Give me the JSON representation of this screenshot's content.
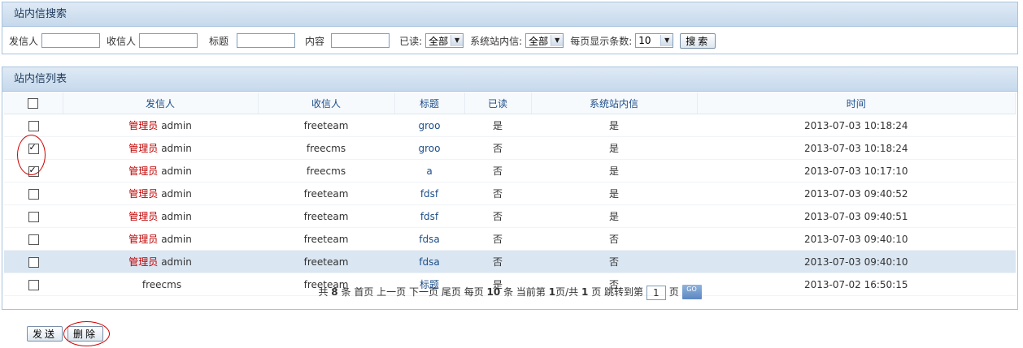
{
  "search": {
    "title": "站内信搜索",
    "sender_label": "发信人",
    "receiver_label": "收信人",
    "subject_label": "标题",
    "content_label": "内容",
    "read_label": "已读:",
    "read_value": "全部",
    "system_label": "系统站内信:",
    "system_value": "全部",
    "pagesize_label": "每页显示条数:",
    "pagesize_value": "10",
    "search_button": "搜索"
  },
  "list": {
    "title": "站内信列表",
    "columns": [
      "发信人",
      "收信人",
      "标题",
      "已读",
      "系统站内信",
      "时间"
    ],
    "rows": [
      {
        "role": "管理员",
        "sender": "admin",
        "receiver": "freeteam",
        "subject": "groo",
        "read": "是",
        "system": "是",
        "time": "2013-07-03 10:18:24",
        "checked": false
      },
      {
        "role": "管理员",
        "sender": "admin",
        "receiver": "freecms",
        "subject": "groo",
        "read": "否",
        "system": "是",
        "time": "2013-07-03 10:18:24",
        "checked": true
      },
      {
        "role": "管理员",
        "sender": "admin",
        "receiver": "freecms",
        "subject": "a",
        "read": "否",
        "system": "是",
        "time": "2013-07-03 10:17:10",
        "checked": true
      },
      {
        "role": "管理员",
        "sender": "admin",
        "receiver": "freeteam",
        "subject": "fdsf",
        "read": "否",
        "system": "是",
        "time": "2013-07-03 09:40:52",
        "checked": false
      },
      {
        "role": "管理员",
        "sender": "admin",
        "receiver": "freeteam",
        "subject": "fdsf",
        "read": "否",
        "system": "是",
        "time": "2013-07-03 09:40:51",
        "checked": false
      },
      {
        "role": "管理员",
        "sender": "admin",
        "receiver": "freeteam",
        "subject": "fdsa",
        "read": "否",
        "system": "否",
        "time": "2013-07-03 09:40:10",
        "checked": false
      },
      {
        "role": "管理员",
        "sender": "admin",
        "receiver": "freeteam",
        "subject": "fdsa",
        "read": "否",
        "system": "否",
        "time": "2013-07-03 09:40:10",
        "checked": false
      },
      {
        "role": "",
        "sender": "freecms",
        "receiver": "freeteam",
        "subject": "标题",
        "read": "是",
        "system": "否",
        "time": "2013-07-02 16:50:15",
        "checked": false
      }
    ]
  },
  "pager": {
    "total_prefix": "共",
    "total": "8",
    "total_suffix": "条",
    "first": "首页",
    "prev": "上一页",
    "next": "下一页",
    "last": "尾页",
    "per_prefix": "每页",
    "per": "10",
    "per_suffix": "条",
    "current_prefix": "当前第",
    "current": "1",
    "of_text": "页/共",
    "pages": "1",
    "pages_suffix": "页",
    "jump_prefix": "跳转到第",
    "jump_value": "1",
    "jump_suffix": "页",
    "go": "GO"
  },
  "actions": {
    "send": "发送",
    "delete": "删除"
  }
}
